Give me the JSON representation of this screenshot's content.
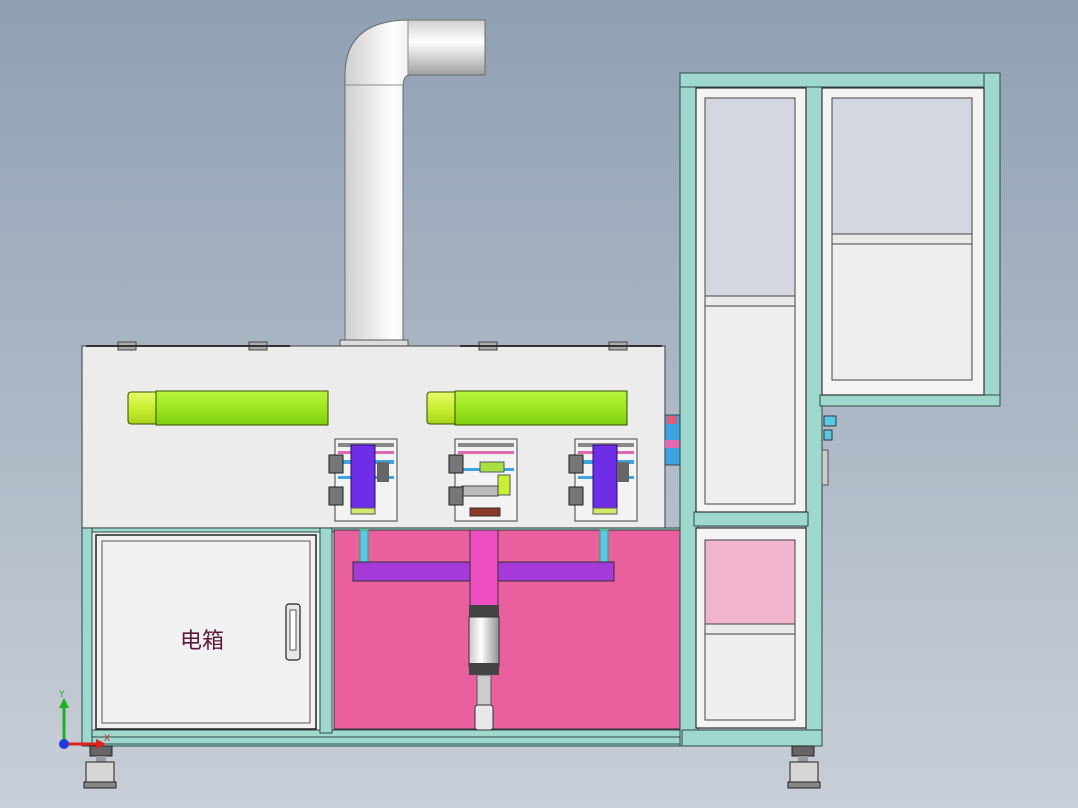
{
  "viewport": {
    "background_top": "#8fa0b3",
    "background_bottom": "#c9cfd8"
  },
  "machine": {
    "electrical_box_label": "电箱",
    "colors": {
      "frame_teal": "#9fd8cc",
      "frame_edge": "#2f4a45",
      "top_panel": "#ececec",
      "pink_panel": "#ea5f9e",
      "light_pink": "#f0b4cc",
      "lime_cylinder": "#9ce91f",
      "lime_cap": "#c9f032",
      "purple_cylinder": "#6d2ee6",
      "magenta_bar": "#a63ad8",
      "pink_rod": "#ee4fc0",
      "blue_bar": "#3ea4e0",
      "duct_light": "#f4f4f4",
      "duct_shadow": "#a9a9a9",
      "glass_gray": "#d4d7df",
      "cabinet_white": "#f1f1f3"
    }
  },
  "triad": {
    "y_label": "Y",
    "x_label": "X",
    "y_color": "#1db11d",
    "x_color": "#e02020",
    "z_color": "#1d3ae0"
  }
}
